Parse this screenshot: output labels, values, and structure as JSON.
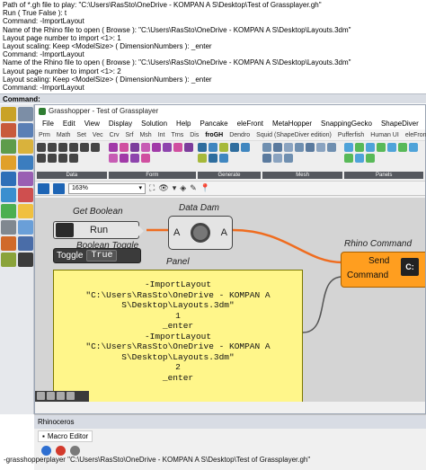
{
  "history": {
    "lines": [
      "Path of *.gh file to play: \"C:\\Users\\RasSto\\OneDrive - KOMPAN A S\\Desktop\\Test of Grassplayer.gh\"",
      "Run ( True  False ): t",
      "Command: -ImportLayout",
      "Name of the Rhino file to open ( Browse ): \"C:\\Users\\RasSto\\OneDrive - KOMPAN A S\\Desktop\\Layouts.3dm\"",
      "Layout page number to import <1>: 1",
      "Layout scaling: Keep <ModelSize> ( DimensionNumbers ): _enter",
      "Command: -ImportLayout",
      "Name of the Rhino file to open ( Browse ): \"C:\\Users\\RasSto\\OneDrive - KOMPAN A S\\Desktop\\Layouts.3dm\"",
      "Layout page number to import <1>: 2",
      "Layout scaling: Keep <ModelSize> ( DimensionNumbers ): _enter",
      "Command: -ImportLayout"
    ],
    "prompt": "Command:"
  },
  "gh": {
    "title": "Grasshopper - Test of Grassplayer",
    "menu": [
      "File",
      "Edit",
      "View",
      "Display",
      "Solution",
      "Help",
      "Pancake",
      "eleFront",
      "MetaHopper",
      "SnappingGecko",
      "ShapeDiver"
    ],
    "tabs": [
      "Prm",
      "Math",
      "Set",
      "Vec",
      "Crv",
      "Srf",
      "Msh",
      "Int",
      "Trns",
      "Dis",
      "froGH",
      "Dendro",
      "Squid (ShapeDiver edition)",
      "Pufferfish",
      "Human UI",
      "eleFront"
    ],
    "ribbon_groups": [
      "Data",
      "Form",
      "Generate",
      "Mesh",
      "Panels"
    ],
    "zoom": "163%",
    "components": {
      "get_boolean_label": "Get Boolean",
      "run_label": "Run",
      "boolean_toggle_label": "Boolean Toggle",
      "toggle_name": "Toggle",
      "toggle_value": "True",
      "data_dam_label": "Data Dam",
      "port_a": "A",
      "rhino_command_label": "Rhino Command",
      "send_label": "Send",
      "command_label": "Command",
      "cmd_icon_text": "C:",
      "panel_label": "Panel",
      "panel_lines": [
        "-ImportLayout",
        "\"C:\\Users\\RasSto\\OneDrive - KOMPAN A",
        "S\\Desktop\\Layouts.3dm\"",
        "1",
        "_enter",
        "-ImportLayout",
        "\"C:\\Users\\RasSto\\OneDrive - KOMPAN A",
        "S\\Desktop\\Layouts.3dm\"",
        "2",
        "_enter"
      ]
    }
  },
  "rhino_panel": {
    "title": "Rhinoceros",
    "macro_tab": "Macro Editor",
    "macro_text": "-grasshopperplayer \"C:\\Users\\RasSto\\OneDrive - KOMPAN A S\\Desktop\\Test of Grassplayer.gh\""
  }
}
